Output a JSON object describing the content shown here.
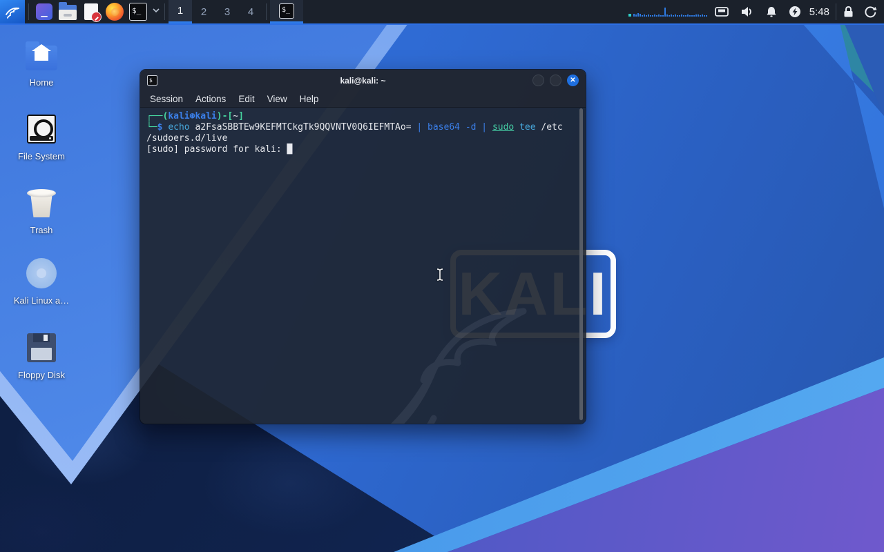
{
  "colors": {
    "accent_blue": "#2D6FE4",
    "panel_bg": "#1B212B",
    "terminal_bg": "#1E242F",
    "prompt_frame_green": "#46D49F",
    "prompt_user_blue": "#3B7FE8",
    "command_cyan": "#47A8DC",
    "sudo_teal": "#45CDA4",
    "terminal_fg": "#E4E6EB",
    "wallpaper_blue": "#2F6BD4",
    "wallpaper_navy": "#0F2148"
  },
  "panel": {
    "launcher_icons": [
      "kali-menu",
      "window-app",
      "file-manager",
      "text-editor",
      "firefox",
      "terminal-emulator"
    ],
    "terminal_launcher_glyph": "$_",
    "workspaces": {
      "items": [
        "1",
        "2",
        "3",
        "4"
      ],
      "active": "1"
    },
    "taskbar": {
      "items": [
        {
          "icon": "terminal",
          "glyph": "$_",
          "active": true
        }
      ]
    },
    "cpu_graph_bars": [
      4,
      3,
      5,
      4,
      2,
      3,
      2,
      3,
      2,
      2,
      3,
      2,
      3,
      2,
      2,
      13,
      3,
      2,
      3,
      2,
      3,
      2,
      2,
      3,
      2,
      2,
      3,
      2,
      2,
      2,
      3,
      3,
      2,
      3,
      2,
      2
    ],
    "tray_icons": [
      "network-wired",
      "audio-volume",
      "notifications",
      "power-manager"
    ],
    "clock": "5:48",
    "session_icons": [
      "lock-screen",
      "log-out"
    ]
  },
  "desktop": {
    "icons": [
      {
        "label": "Home",
        "icon": "home-folder"
      },
      {
        "label": "File System",
        "icon": "file-system-drive"
      },
      {
        "label": "Trash",
        "icon": "trash-bin"
      },
      {
        "label": "Kali Linux a…",
        "icon": "optical-disc"
      },
      {
        "label": "Floppy Disk",
        "icon": "floppy-disk"
      }
    ],
    "watermark_text": "KALI"
  },
  "terminal": {
    "title": "kali@kali: ~",
    "menu": [
      "Session",
      "Actions",
      "Edit",
      "View",
      "Help"
    ],
    "window_buttons": [
      "minimize",
      "maximize",
      "close"
    ],
    "close_glyph": "✕",
    "output_lines": [
      [
        {
          "t": "┌──(",
          "c": "frame"
        },
        {
          "t": "kali⊛kali",
          "c": "user"
        },
        {
          "t": ")-[",
          "c": "frame"
        },
        {
          "t": "~",
          "c": "fg"
        },
        {
          "t": "]",
          "c": "frame"
        }
      ],
      [
        {
          "t": "└─",
          "c": "frame"
        },
        {
          "t": "$",
          "c": "user"
        },
        {
          "t": " ",
          "c": "fg"
        },
        {
          "t": "echo",
          "c": "cmd"
        },
        {
          "t": " a2FsaSBBTEw9KEFMTCkgTk9QQVNTV0Q6IEFMTAo= ",
          "c": "fg"
        },
        {
          "t": "|",
          "c": "blue"
        },
        {
          "t": " ",
          "c": "fg"
        },
        {
          "t": "base64",
          "c": "blue"
        },
        {
          "t": " ",
          "c": "fg"
        },
        {
          "t": "-d",
          "c": "blue"
        },
        {
          "t": " ",
          "c": "fg"
        },
        {
          "t": "|",
          "c": "blue"
        },
        {
          "t": " ",
          "c": "fg"
        },
        {
          "t": "sudo",
          "c": "sudo"
        },
        {
          "t": " ",
          "c": "fg"
        },
        {
          "t": "tee",
          "c": "cmd"
        },
        {
          "t": " /etc",
          "c": "fg"
        }
      ],
      [
        {
          "t": "/sudoers.d/live",
          "c": "fg"
        }
      ],
      [
        {
          "t": "[sudo] password for kali: ",
          "c": "fg"
        },
        {
          "t": "█",
          "c": "cursor"
        }
      ]
    ]
  }
}
